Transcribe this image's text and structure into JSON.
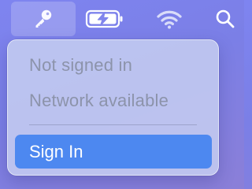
{
  "menubar": {
    "items": [
      {
        "icon": "key-icon",
        "active": true
      },
      {
        "icon": "battery-charging-icon"
      },
      {
        "icon": "wifi-icon"
      },
      {
        "icon": "search-icon"
      }
    ]
  },
  "menu": {
    "status_line_1": "Not signed in",
    "status_line_2": "Network available",
    "action_label": "Sign In"
  },
  "colors": {
    "highlight": "#4d88f0",
    "disabled_text": "#8c93aa",
    "menu_background": "#c4ccf0"
  }
}
